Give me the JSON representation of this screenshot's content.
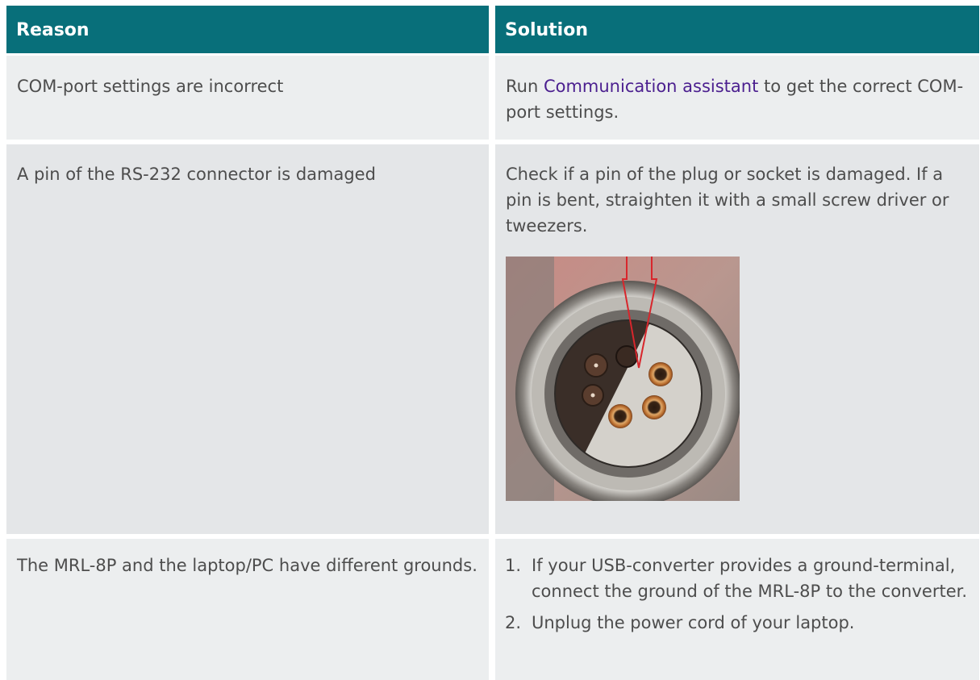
{
  "table": {
    "headers": {
      "reason": "Reason",
      "solution": "Solution"
    },
    "row1": {
      "reason": "COM-port settings are incorrect",
      "solution_prefix": "Run ",
      "solution_link": "Communication assistant",
      "solution_suffix": " to get the correct COM-port settings."
    },
    "row2": {
      "reason": "A pin of the RS-232 connector is damaged",
      "solution": "Check if a pin of the plug or socket is damaged. If a pin is bent, straighten it with a small screw driver or tweezers."
    },
    "row3": {
      "reason": "The MRL-8P and the laptop/PC have different grounds.",
      "steps": [
        {
          "num": "1.",
          "text": "If your USB-converter provides a ground-terminal, connect the ground of the MRL-8P to the converter."
        },
        {
          "num": "2.",
          "text": "Unplug the power cord of your laptop."
        }
      ]
    }
  },
  "colors": {
    "header_bg": "#086f7a",
    "link": "#4b1f8f",
    "arrow": "#d8262c"
  },
  "icons": {
    "photo": "connector-photo"
  }
}
